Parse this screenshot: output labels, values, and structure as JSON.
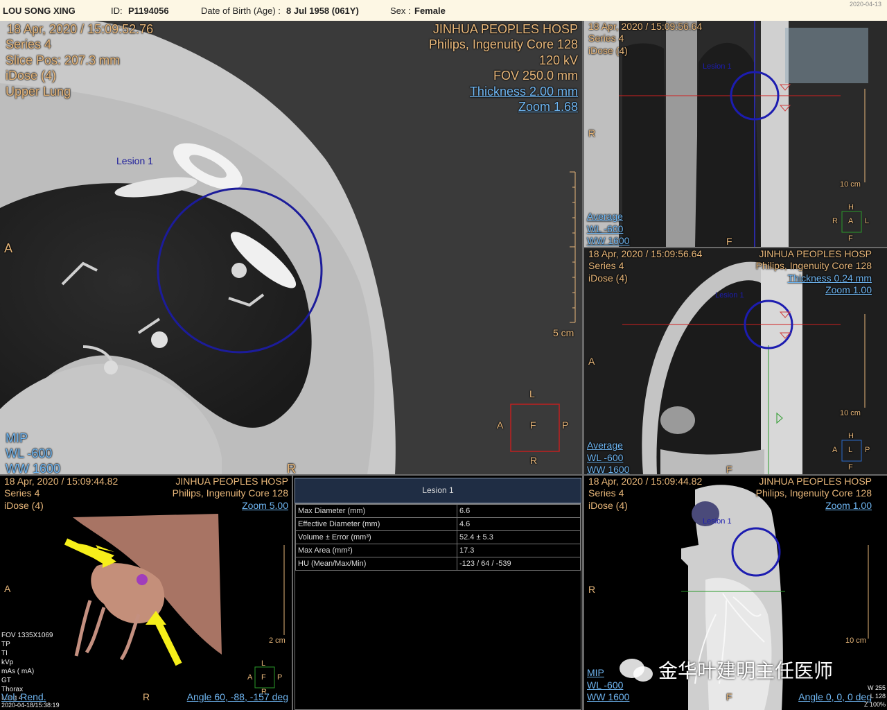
{
  "header": {
    "patient_name": "LOU SONG XING",
    "id_label": "ID:",
    "id_value": "P1194056",
    "dob_label": "Date of Birth (Age) :",
    "dob_value": "8 Jul 1958 (061Y)",
    "sex_label": "Sex :",
    "sex_value": "Female",
    "corner_date": "2020-04-13"
  },
  "main_view": {
    "datetime": "18 Apr, 2020 / 15:09:52.76",
    "series": "Series 4",
    "slice_pos": "Slice Pos: 207.3 mm",
    "dose": "iDose (4)",
    "region": "Upper Lung",
    "hospital": "JINHUA PEOPLES HOSP",
    "scanner": "Philips, Ingenuity Core 128",
    "kv": "120 kV",
    "fov": "FOV 250.0 mm",
    "thickness": "Thickness 2.00 mm",
    "zoom": "Zoom 1.68",
    "lesion_label": "Lesion 1",
    "orient_left": "A",
    "orient_bottom": "R",
    "scale_label": "5 cm",
    "cube": {
      "top": "L",
      "left": "A",
      "center": "F",
      "right": "P",
      "bottom": "R"
    },
    "render_mode": "MIP",
    "wl": "WL  -600",
    "ww": "WW  1600"
  },
  "top_right_view": {
    "datetime": "18 Apr, 2020 / 15:09:56.64",
    "series": "Series 4",
    "dose": "iDose (4)",
    "lesion_label": "Lesion 1",
    "orient_left": "R",
    "scale_label": "10 cm",
    "render_mode": "Average",
    "wl": "WL  -600",
    "ww": "WW  1600",
    "bottom": "F",
    "cube": {
      "top": "H",
      "left": "R",
      "center": "A",
      "right": "L",
      "bottom": "F"
    }
  },
  "mid_right_view": {
    "datetime": "18 Apr, 2020 / 15:09:56.64",
    "series": "Series 4",
    "dose": "iDose (4)",
    "hospital": "JINHUA PEOPLES HOSP",
    "scanner": "Philips, Ingenuity Core 128",
    "thickness": "Thickness 0.24 mm",
    "zoom": "Zoom 1.00",
    "lesion_label": "Lesion 1",
    "orient_left": "A",
    "scale_label": "10 cm",
    "render_mode": "Average",
    "wl": "WL  -600",
    "ww": "WW  1600",
    "bottom": "F",
    "cube": {
      "top": "H",
      "left": "A",
      "center": "L",
      "right": "P",
      "bottom": "F"
    }
  },
  "bottom_left_view": {
    "datetime": "18 Apr, 2020 / 15:09:44.82",
    "series": "Series 4",
    "dose": "iDose (4)",
    "hospital": "JINHUA PEOPLES HOSP",
    "scanner": "Philips, Ingenuity Core 128",
    "zoom": "Zoom 5.00",
    "orient_left": "A",
    "orient_bottom": "R",
    "scale_label": "2 cm",
    "tech_lines": [
      "FOV 1335X1069",
      "TP",
      "TI",
      "kVp",
      "mAs ( mA)",
      "GT",
      "Thorax",
      "Lung 4"
    ],
    "render_mode": "Vol. Rend.",
    "footer_date": "2020-04-18/15:38:19",
    "angle": "Angle 60, -88, -157 deg",
    "cube": {
      "top": "L",
      "left": "A",
      "center": "F",
      "right": "P",
      "bottom": "R"
    }
  },
  "lesion_table": {
    "title": "Lesion 1",
    "rows": [
      {
        "label": "Max Diameter (mm)",
        "value": "6.6"
      },
      {
        "label": "Effective Diameter (mm)",
        "value": "4.6"
      },
      {
        "label": "Volume ± Error (mm³)",
        "value": "52.4 ± 5.3"
      },
      {
        "label": "Max Area (mm²)",
        "value": "17.3"
      },
      {
        "label": "HU (Mean/Max/Min)",
        "value": "-123 / 64 / -539"
      }
    ]
  },
  "bottom_right_view": {
    "datetime": "18 Apr, 2020 / 15:09:44.82",
    "series": "Series 4",
    "dose": "iDose (4)",
    "hospital": "JINHUA PEOPLES HOSP",
    "scanner": "Philips, Ingenuity Core 128",
    "zoom": "Zoom 1.00",
    "lesion_label": "Lesion 1",
    "orient_left": "R",
    "scale_label": "10 cm",
    "render_mode": "MIP",
    "wl": "WL  -600",
    "ww": "WW  1600",
    "bottom": "F",
    "angle": "Angle 0, 0, 0 deg",
    "corner_w": "W 255",
    "corner_l": "L 128",
    "corner_z": "Z 100%"
  },
  "watermark": "金华叶建明主任医师"
}
